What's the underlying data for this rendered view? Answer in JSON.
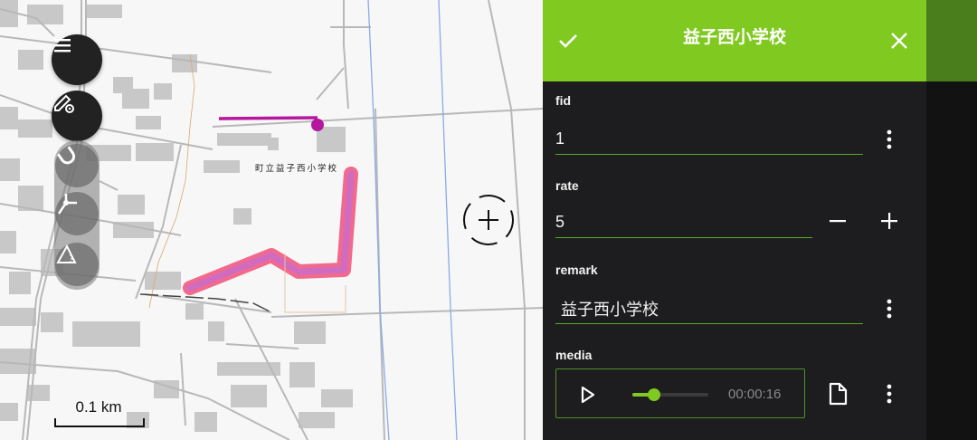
{
  "map": {
    "school_label": "町立益子西小学校",
    "scale_label": "0.1 km",
    "controls": [
      "menu-icon",
      "edit-settings-icon",
      "snap-magnet-icon",
      "vertex-tool-icon",
      "angle-tool-icon",
      "crosshair-icon"
    ]
  },
  "form": {
    "title": "益子西小学校",
    "confirm_icon": "check-icon",
    "close_icon": "close-icon",
    "fields": {
      "fid": {
        "label": "fid",
        "value": "1"
      },
      "rate": {
        "label": "rate",
        "value": "5"
      },
      "remark": {
        "label": "remark",
        "value": "益子西小学校"
      },
      "media": {
        "label": "media",
        "time": "00:00:16",
        "progress": 0.28
      }
    }
  },
  "colors": {
    "header": "#7fc920",
    "panel_bg": "#1d1d1f",
    "accent_line": "#5aa62a",
    "highlight_line": "#b5179e",
    "polygon_fill": "#e0609a"
  }
}
